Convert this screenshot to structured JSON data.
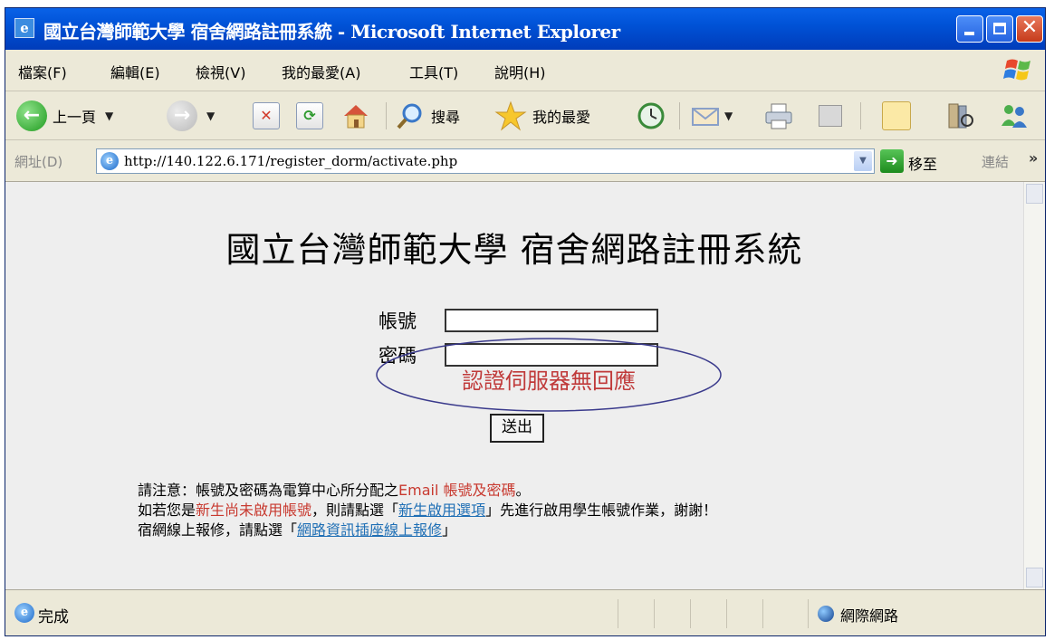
{
  "window": {
    "title": "國立台灣師範大學 宿舍網路註冊系統 - Microsoft Internet Explorer",
    "icon_glyph": "e"
  },
  "menu": {
    "items": [
      {
        "label": "檔案(F)"
      },
      {
        "label": "編輯(E)"
      },
      {
        "label": "檢視(V)"
      },
      {
        "label": "我的最愛(A)"
      },
      {
        "label": "工具(T)"
      },
      {
        "label": "說明(H)"
      }
    ]
  },
  "toolbar": {
    "back_label": "上一頁",
    "search_label": "搜尋",
    "favorites_label": "我的最愛"
  },
  "address": {
    "label": "網址(D)",
    "url": "http://140.122.6.171/register_dorm/activate.php",
    "go_label": "移至",
    "links_label": "連結",
    "more_glyph": "»"
  },
  "page": {
    "title": "國立台灣師範大學 宿舍網路註冊系統",
    "account_label": "帳號",
    "password_label": "密碼",
    "error_message": "認證伺服器無回應",
    "submit_label": "送出",
    "notes": {
      "line1_prefix": "請注意：帳號及密碼為電算中心所分配之",
      "line1_red": "Email 帳號及密碼",
      "line1_suffix": "。",
      "line2_prefix": "如若您是",
      "line2_red": "新生尚未啟用帳號",
      "line2_mid": "，則請點選「",
      "line2_link": "新生啟用選項",
      "line2_suffix": "」先進行啟用學生帳號作業，謝謝！",
      "line3_prefix": "宿網線上報修，請點選「",
      "line3_link": "網路資訊插座線上報修",
      "line3_suffix": "」"
    }
  },
  "status": {
    "text": "完成",
    "zone": "網際網路"
  },
  "colors": {
    "titlebar": "#0052d6",
    "error_red": "#c03a3a",
    "ellipse_stroke": "#3a3a8c",
    "link_blue": "#1f6fb5"
  }
}
